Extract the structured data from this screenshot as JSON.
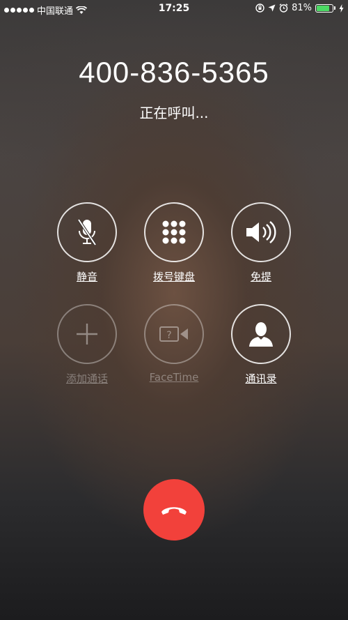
{
  "status_bar": {
    "carrier": "中国联通",
    "time": "17:25",
    "battery_percent": "81%",
    "battery_level": 0.81,
    "battery_color": "#4cd964"
  },
  "call": {
    "number": "400-836-5365",
    "status": "正在呼叫..."
  },
  "buttons": [
    {
      "label": "静音",
      "icon": "microphone-muted-icon",
      "enabled": true
    },
    {
      "label": "拨号键盘",
      "icon": "keypad-icon",
      "enabled": true
    },
    {
      "label": "免提",
      "icon": "speaker-icon",
      "enabled": true
    },
    {
      "label": "添加通话",
      "icon": "plus-icon",
      "enabled": false
    },
    {
      "label": "FaceTime",
      "icon": "facetime-icon",
      "enabled": false
    },
    {
      "label": "通讯录",
      "icon": "contacts-icon",
      "enabled": true
    }
  ],
  "end_call": {
    "icon": "end-call-icon",
    "color": "#f2413b"
  }
}
